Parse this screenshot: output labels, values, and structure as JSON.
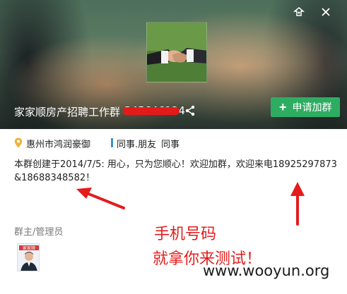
{
  "header": {
    "group_name": "家家顺房产招聘工作群",
    "group_id": "345646124",
    "join_button_label": "申请加群",
    "icons": [
      "skin-icon",
      "close-icon",
      "share-icon",
      "plus-icon"
    ]
  },
  "tags": {
    "location": "惠州市鸿润豪御",
    "category": "同事.朋友",
    "subcategory": "同事"
  },
  "intro": {
    "text": "本群创建于2014/7/5: 用心，只为您顺心！欢迎加群，欢迎来电18925297873&18688348582！"
  },
  "members": {
    "section_title": "群主/管理员",
    "owner_avatar_caption": "家家顺"
  },
  "annotation": {
    "line1": "手机号码",
    "line2": "就拿你来测试！",
    "color": "#e41c1c"
  },
  "watermark": "www.wooyun.org",
  "colors": {
    "join_button": "#2ead62",
    "tag_bar": "#3a8fd8",
    "redaction": "#e41a1a"
  }
}
